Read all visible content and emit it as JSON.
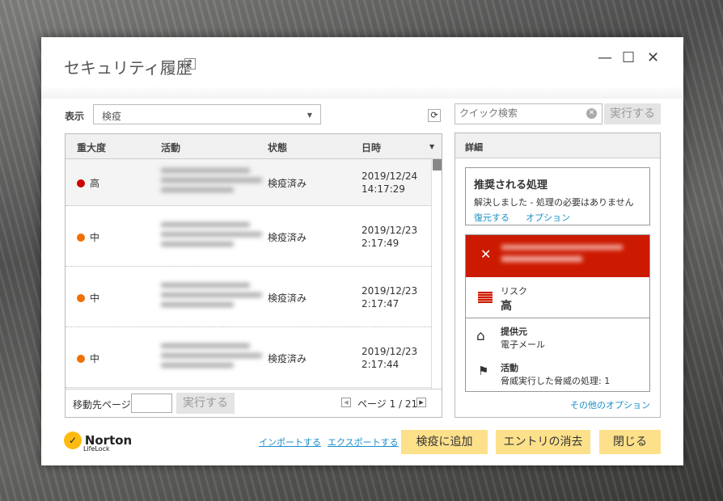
{
  "window": {
    "title": "セキュリティ履歴",
    "help": "?",
    "min": "—",
    "max": "☐",
    "close": "✕"
  },
  "filter": {
    "label": "表示",
    "value": "検疫"
  },
  "search": {
    "placeholder": "クイック検索",
    "button": "実行する"
  },
  "table": {
    "headers": [
      "重大度",
      "活動",
      "状態",
      "日時"
    ],
    "rows": [
      {
        "severity": "高",
        "color": "#cc0000",
        "status": "検疫済み",
        "date": "2019/12/24",
        "time": "14:17:29"
      },
      {
        "severity": "中",
        "color": "#f07000",
        "status": "検疫済み",
        "date": "2019/12/23",
        "time": "2:17:49"
      },
      {
        "severity": "中",
        "color": "#f07000",
        "status": "検疫済み",
        "date": "2019/12/23",
        "time": "2:17:47"
      },
      {
        "severity": "中",
        "color": "#f07000",
        "status": "検疫済み",
        "date": "2019/12/23",
        "time": "2:17:44"
      }
    ]
  },
  "footer": {
    "goto_label": "移動先ページ:",
    "goto_button": "実行する",
    "page": "ページ 1 / 21"
  },
  "details": {
    "header": "詳細",
    "rec_title": "推奨される処理",
    "rec_text": "解決しました - 処理の必要はありません",
    "restore": "復元する",
    "options": "オプション",
    "risk_label": "リスク",
    "risk_value": "高",
    "source_label": "提供元",
    "source_value": "電子メール",
    "activity_label": "活動",
    "activity_value": "脅威実行した脅威の処理: 1",
    "more": "その他のオプション"
  },
  "bottom": {
    "import": "インポートする",
    "export": "エクスポートする",
    "add": "検疫に追加",
    "clear": "エントリの消去",
    "close": "閉じる"
  },
  "brand": {
    "name": "Norton",
    "sub": "LifeLock"
  }
}
